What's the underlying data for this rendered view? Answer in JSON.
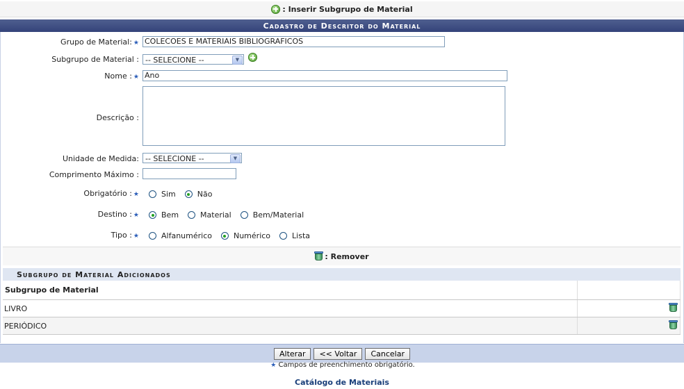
{
  "top_action": {
    "label": ": Inserir Subgrupo de Material"
  },
  "form": {
    "title": "Cadastro de Descritor do Material",
    "grupo": {
      "label": "Grupo de Material:",
      "value": "COLECOES E MATERIAIS BIBLIOGRAFICOS"
    },
    "subgrupo": {
      "label": "Subgrupo de Material :",
      "selected": "-- SELECIONE --"
    },
    "nome": {
      "label": "Nome :",
      "value": "Ano"
    },
    "descricao": {
      "label": "Descrição :",
      "value": ""
    },
    "unidade": {
      "label": "Unidade de Medida:",
      "selected": "-- SELECIONE --"
    },
    "comprimento": {
      "label": "Comprimento Máximo :",
      "value": ""
    },
    "obrigatorio": {
      "label": "Obrigatório :",
      "options": [
        "Sim",
        "Não"
      ],
      "selected": "Não"
    },
    "destino": {
      "label": "Destino :",
      "options": [
        "Bem",
        "Material",
        "Bem/Material"
      ],
      "selected": "Bem"
    },
    "tipo": {
      "label": "Tipo :",
      "options": [
        "Alfanumérico",
        "Numérico",
        "Lista"
      ],
      "selected": "Numérico"
    },
    "remove_legend": ": Remover"
  },
  "subgroups": {
    "title": "Subgrupo de Material Adicionados",
    "column_header": "Subgrupo de Material",
    "rows": [
      {
        "name": "LIVRO"
      },
      {
        "name": "PERIÓDICO"
      }
    ]
  },
  "buttons": {
    "alterar": "Alterar",
    "voltar": "<< Voltar",
    "cancelar": "Cancelar"
  },
  "required_note": " Campos de preenchimento obrigatório.",
  "footer_link": "Catálogo de Materiais",
  "colors": {
    "header_bg": "#3e4d82",
    "footer_bg": "#c8d3ea",
    "star": "#2b5db8",
    "link": "#1a3f7a"
  }
}
